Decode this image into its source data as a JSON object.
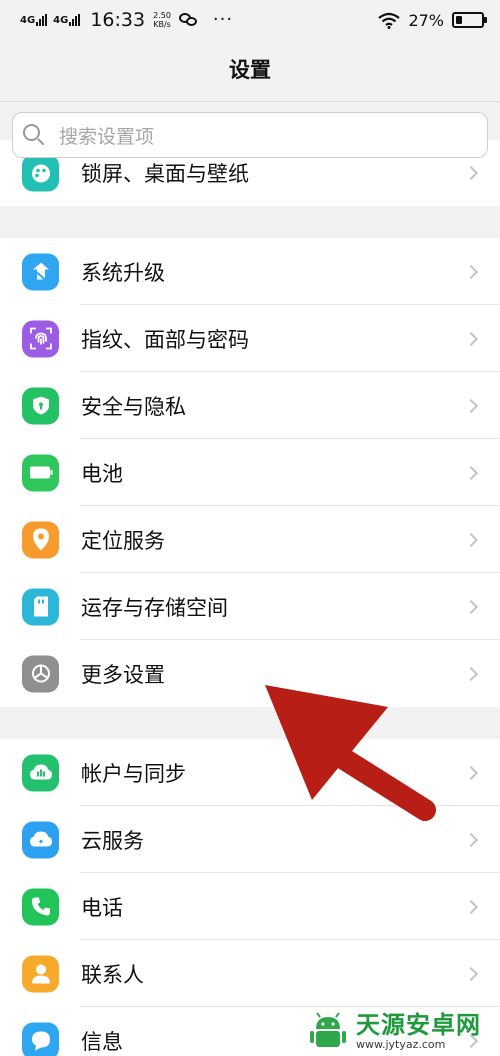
{
  "status_bar": {
    "network1": "4G",
    "network2": "4G",
    "time": "16:33",
    "speed_value": "2.50",
    "speed_unit": "KB/s",
    "more": "···",
    "battery_percent": "27%",
    "battery_level": 0.27
  },
  "header": {
    "title": "设置"
  },
  "search": {
    "placeholder": "搜索设置项"
  },
  "list": {
    "partial_item": {
      "label": "锁屏、桌面与壁纸",
      "icon": "palette-icon",
      "color": "#22c0b4"
    },
    "group1": [
      {
        "label": "系统升级",
        "icon": "upgrade-icon",
        "color": "#2ea6f2"
      },
      {
        "label": "指纹、面部与密码",
        "icon": "fingerprint-icon",
        "color": "#9d5ce6"
      },
      {
        "label": "安全与隐私",
        "icon": "shield-icon",
        "color": "#22c265"
      },
      {
        "label": "电池",
        "icon": "battery-icon",
        "color": "#2fc65c"
      },
      {
        "label": "定位服务",
        "icon": "location-icon",
        "color": "#f79b2c"
      },
      {
        "label": "运存与存储空间",
        "icon": "sd-card-icon",
        "color": "#2ab7d8"
      },
      {
        "label": "更多设置",
        "icon": "gear-icon",
        "color": "#8f8f8f"
      }
    ],
    "group2": [
      {
        "label": "帐户与同步",
        "icon": "account-sync-icon",
        "color": "#23c06d"
      },
      {
        "label": "云服务",
        "icon": "cloud-icon",
        "color": "#2ea0f0"
      },
      {
        "label": "电话",
        "icon": "phone-icon",
        "color": "#22c45a"
      },
      {
        "label": "联系人",
        "icon": "contact-icon",
        "color": "#f7a92b"
      },
      {
        "label": "信息",
        "icon": "message-icon",
        "color": "#2ea6f2"
      }
    ]
  },
  "annotation": {
    "arrow_color": "#b71f16"
  },
  "watermark": {
    "name": "天源安卓网",
    "url": "www.jytyaz.com"
  }
}
